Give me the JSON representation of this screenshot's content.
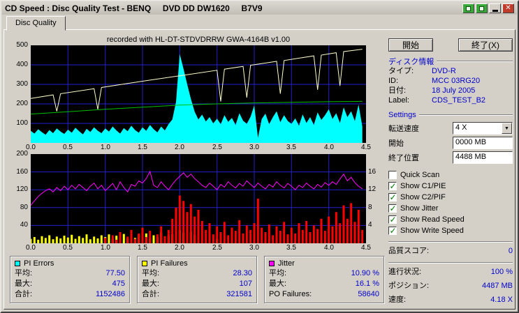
{
  "window": {
    "title": "CD Speed : Disc Quality Test - BENQ     DVD DD DW1620     B7V9"
  },
  "tab": {
    "label": "Disc Quality"
  },
  "chart_header": "recorded with HL-DT-STDVDRRW GWA-4164B v1.00",
  "buttons": {
    "start": "開始",
    "exit": "終了(X)"
  },
  "disc_info": {
    "header": "ディスク情報",
    "fields": [
      {
        "label": "タイプ:",
        "value": "DVD-R"
      },
      {
        "label": "ID:",
        "value": "MCC 03RG20"
      },
      {
        "label": "日付:",
        "value": "18 July 2005"
      },
      {
        "label": "Label:",
        "value": "CDS_TEST_B2"
      }
    ]
  },
  "settings": {
    "header": "Settings",
    "speed_label": "転送速度",
    "speed_value": "4 X",
    "start_label": "開始",
    "start_value": "0000 MB",
    "end_label": "終了位置",
    "end_value": "4488 MB",
    "quick_scan": {
      "label": "Quick Scan",
      "checked": false
    },
    "checkboxes": [
      {
        "label": "Show C1/PIE",
        "checked": true
      },
      {
        "label": "Show C2/PIF",
        "checked": true
      },
      {
        "label": "Show Jitter",
        "checked": true
      },
      {
        "label": "Show Read Speed",
        "checked": true
      },
      {
        "label": "Show Write Speed",
        "checked": true
      }
    ]
  },
  "quality": {
    "score_label": "品質スコア:",
    "score_value": "0"
  },
  "status": [
    {
      "label": "進行状況:",
      "value": "100 %"
    },
    {
      "label": "ポジション:",
      "value": "4487 MB"
    },
    {
      "label": "速度:",
      "value": "4.18 X"
    }
  ],
  "stats": [
    {
      "swatch": "#00ffff",
      "title": "PI Errors",
      "rows": [
        [
          "平均:",
          "77.50"
        ],
        [
          "最大:",
          "475"
        ],
        [
          "合計:",
          "1152486"
        ]
      ]
    },
    {
      "swatch": "#ffff00",
      "title": "PI Failures",
      "rows": [
        [
          "平均:",
          "28.30"
        ],
        [
          "最大:",
          "107"
        ],
        [
          "合計:",
          "321581"
        ]
      ]
    },
    {
      "swatch": "#ff00ff",
      "title": "Jitter",
      "rows": [
        [
          "平均:",
          "10.90 %"
        ],
        [
          "最大:",
          "16.1 %"
        ],
        [
          "PO Failures:",
          "58640"
        ]
      ]
    }
  ],
  "chart_data": [
    {
      "type": "area",
      "name": "pi-errors-and-speed",
      "bg": "#000000",
      "grid_color": "#2121cd",
      "x_range": [
        0,
        4.5
      ],
      "x_grid_step": 0.5,
      "y_range": [
        0,
        500
      ],
      "y_grid_step": 100,
      "y_ticks_left": [
        "500",
        "400",
        "300",
        "200",
        "100"
      ],
      "x_ticks": [
        "0.0",
        "0.5",
        "1.0",
        "1.5",
        "2.0",
        "2.5",
        "3.0",
        "3.5",
        "4.0",
        "4.5"
      ],
      "series": [
        {
          "name": "PI Errors",
          "type": "area",
          "color": "#00ffff",
          "step": 0.05,
          "values": [
            62,
            48,
            70,
            55,
            42,
            66,
            50,
            74,
            58,
            46,
            68,
            52,
            78,
            60,
            44,
            72,
            56,
            80,
            62,
            50,
            74,
            58,
            84,
            64,
            48,
            76,
            60,
            88,
            66,
            52,
            80,
            62,
            92,
            70,
            54,
            84,
            64,
            96,
            120,
            210,
            455,
            380,
            300,
            225,
            160,
            120,
            145,
            110,
            132,
            100,
            124,
            96,
            142,
            108,
            128,
            92,
            152,
            114,
            98,
            134,
            192,
            26,
            122,
            150,
            96,
            132,
            162,
            106,
            142,
            112,
            98,
            126,
            88,
            146,
            102,
            132,
            92,
            156,
            118,
            142,
            172,
            122,
            152,
            102,
            182,
            132,
            162,
            112,
            196,
            84
          ]
        },
        {
          "name": "Write Speed",
          "type": "line",
          "color": "#00c000",
          "points": [
            [
              0,
              148
            ],
            [
              0.5,
              160
            ],
            [
              1,
              172
            ],
            [
              1.5,
              183
            ],
            [
              2,
              194
            ],
            [
              2.5,
              200
            ],
            [
              3,
              205
            ],
            [
              3.5,
              208
            ],
            [
              4,
              211
            ],
            [
              4.45,
              213
            ]
          ]
        },
        {
          "name": "Read Speed",
          "type": "line",
          "color": "#ffffcc",
          "points": [
            [
              0,
              228
            ],
            [
              0.3,
              246
            ],
            [
              0.35,
              162
            ],
            [
              0.4,
              252
            ],
            [
              0.85,
              278
            ],
            [
              0.9,
              172
            ],
            [
              0.95,
              284
            ],
            [
              1.5,
              316
            ],
            [
              2,
              344
            ],
            [
              2.5,
              372
            ],
            [
              2.55,
              212
            ],
            [
              2.6,
              378
            ],
            [
              2.85,
              392
            ],
            [
              2.9,
              232
            ],
            [
              2.95,
              398
            ],
            [
              3.3,
              418
            ],
            [
              3.35,
              252
            ],
            [
              3.4,
              422
            ],
            [
              3.8,
              446
            ],
            [
              3.85,
              272
            ],
            [
              3.9,
              450
            ],
            [
              4.1,
              462
            ],
            [
              4.15,
              292
            ],
            [
              4.2,
              468
            ],
            [
              4.45,
              480
            ]
          ]
        }
      ]
    },
    {
      "type": "bar",
      "name": "pi-failures-and-jitter",
      "bg": "#000000",
      "grid_color": "#2121cd",
      "x_range": [
        0,
        4.5
      ],
      "x_grid_step": 0.5,
      "y_range": [
        0,
        200
      ],
      "y_grid_step": 40,
      "y_ticks_left": [
        "200",
        "160",
        "120",
        "80",
        "40"
      ],
      "y_ticks_right": [
        "16",
        "12",
        "8",
        "4"
      ],
      "y_right_range": [
        0,
        20
      ],
      "x_ticks": [
        "0.0",
        "0.5",
        "1.0",
        "1.5",
        "2.0",
        "2.5",
        "3.0",
        "3.5",
        "4.0",
        "4.5"
      ],
      "series": [
        {
          "name": "C2",
          "type": "bars",
          "color": "#00c000",
          "step": 0.05,
          "values": [
            4,
            3,
            5,
            4,
            6,
            3,
            5,
            4,
            3,
            6,
            4,
            3,
            5,
            4,
            6,
            3,
            5,
            4,
            3,
            6,
            4,
            3,
            5,
            4,
            6,
            3,
            5,
            4,
            3,
            6,
            4,
            3,
            5,
            4,
            6,
            3,
            5,
            4,
            3,
            6,
            4,
            3,
            5,
            4,
            6,
            0,
            0,
            0,
            0,
            0,
            0,
            0,
            0,
            0,
            0,
            0,
            0,
            0,
            0,
            0,
            0,
            0,
            0,
            0,
            0,
            0,
            0,
            0,
            0,
            0,
            0,
            0,
            0,
            0,
            0,
            0,
            0,
            0,
            0,
            0,
            0,
            0,
            0,
            0,
            0,
            0,
            0,
            0,
            0,
            0
          ]
        },
        {
          "name": "C1",
          "type": "bars",
          "color": "#ffff00",
          "step": 0.05,
          "values": [
            10,
            14,
            8,
            16,
            12,
            18,
            9,
            15,
            11,
            17,
            13,
            19,
            10,
            16,
            12,
            20,
            9,
            15,
            11,
            18,
            14,
            20,
            10,
            17,
            13,
            21,
            11,
            16,
            12,
            19,
            15,
            22,
            12,
            18,
            14,
            24,
            11,
            17,
            20,
            26,
            30,
            24,
            20,
            26,
            18,
            14,
            0,
            0,
            0,
            0,
            10,
            12,
            0,
            0,
            0,
            0,
            0,
            0,
            0,
            0,
            0,
            0,
            0,
            0,
            0,
            0,
            0,
            0,
            0,
            0,
            0,
            0,
            0,
            0,
            0,
            0,
            0,
            0,
            0,
            0,
            0,
            0,
            0,
            0,
            0,
            0,
            0,
            0,
            0,
            0
          ]
        },
        {
          "name": "PI Failures",
          "type": "bars",
          "color": "#ff0000",
          "step": 0.05,
          "values": [
            0,
            0,
            0,
            0,
            0,
            0,
            0,
            0,
            0,
            0,
            0,
            0,
            0,
            0,
            0,
            0,
            0,
            0,
            0,
            0,
            12,
            0,
            18,
            8,
            25,
            0,
            15,
            30,
            10,
            22,
            35,
            14,
            28,
            0,
            20,
            38,
            16,
            30,
            55,
            80,
            107,
            95,
            70,
            88,
            60,
            75,
            50,
            30,
            45,
            20,
            38,
            25,
            48,
            18,
            35,
            28,
            52,
            22,
            40,
            30,
            45,
            100,
            35,
            25,
            42,
            18,
            38,
            28,
            48,
            20,
            35,
            22,
            45,
            30,
            50,
            25,
            40,
            32,
            55,
            28,
            60,
            38,
            70,
            45,
            85,
            55,
            90,
            48,
            75,
            30
          ]
        },
        {
          "name": "Jitter",
          "type": "line",
          "color": "#ff00ff",
          "step": 0.05,
          "values": [
            85,
            95,
            105,
            112,
            118,
            122,
            115,
            125,
            118,
            128,
            120,
            130,
            122,
            132,
            125,
            118,
            128,
            135,
            122,
            130,
            118,
            126,
            134,
            120,
            138,
            125,
            115,
            132,
            128,
            140,
            135,
            145,
            161,
            130,
            125,
            138,
            128,
            120,
            132,
            142,
            150,
            158,
            148,
            155,
            145,
            138,
            130,
            125,
            135,
            128,
            120,
            132,
            126,
            138,
            130,
            124,
            134,
            128,
            140,
            132,
            125,
            135,
            128,
            122,
            132,
            126,
            138,
            130,
            124,
            134,
            128,
            120,
            130,
            125,
            135,
            128,
            122,
            132,
            126,
            136,
            130,
            138,
            132,
            144,
            155,
            140,
            148,
            136,
            128,
            122
          ]
        }
      ]
    }
  ]
}
